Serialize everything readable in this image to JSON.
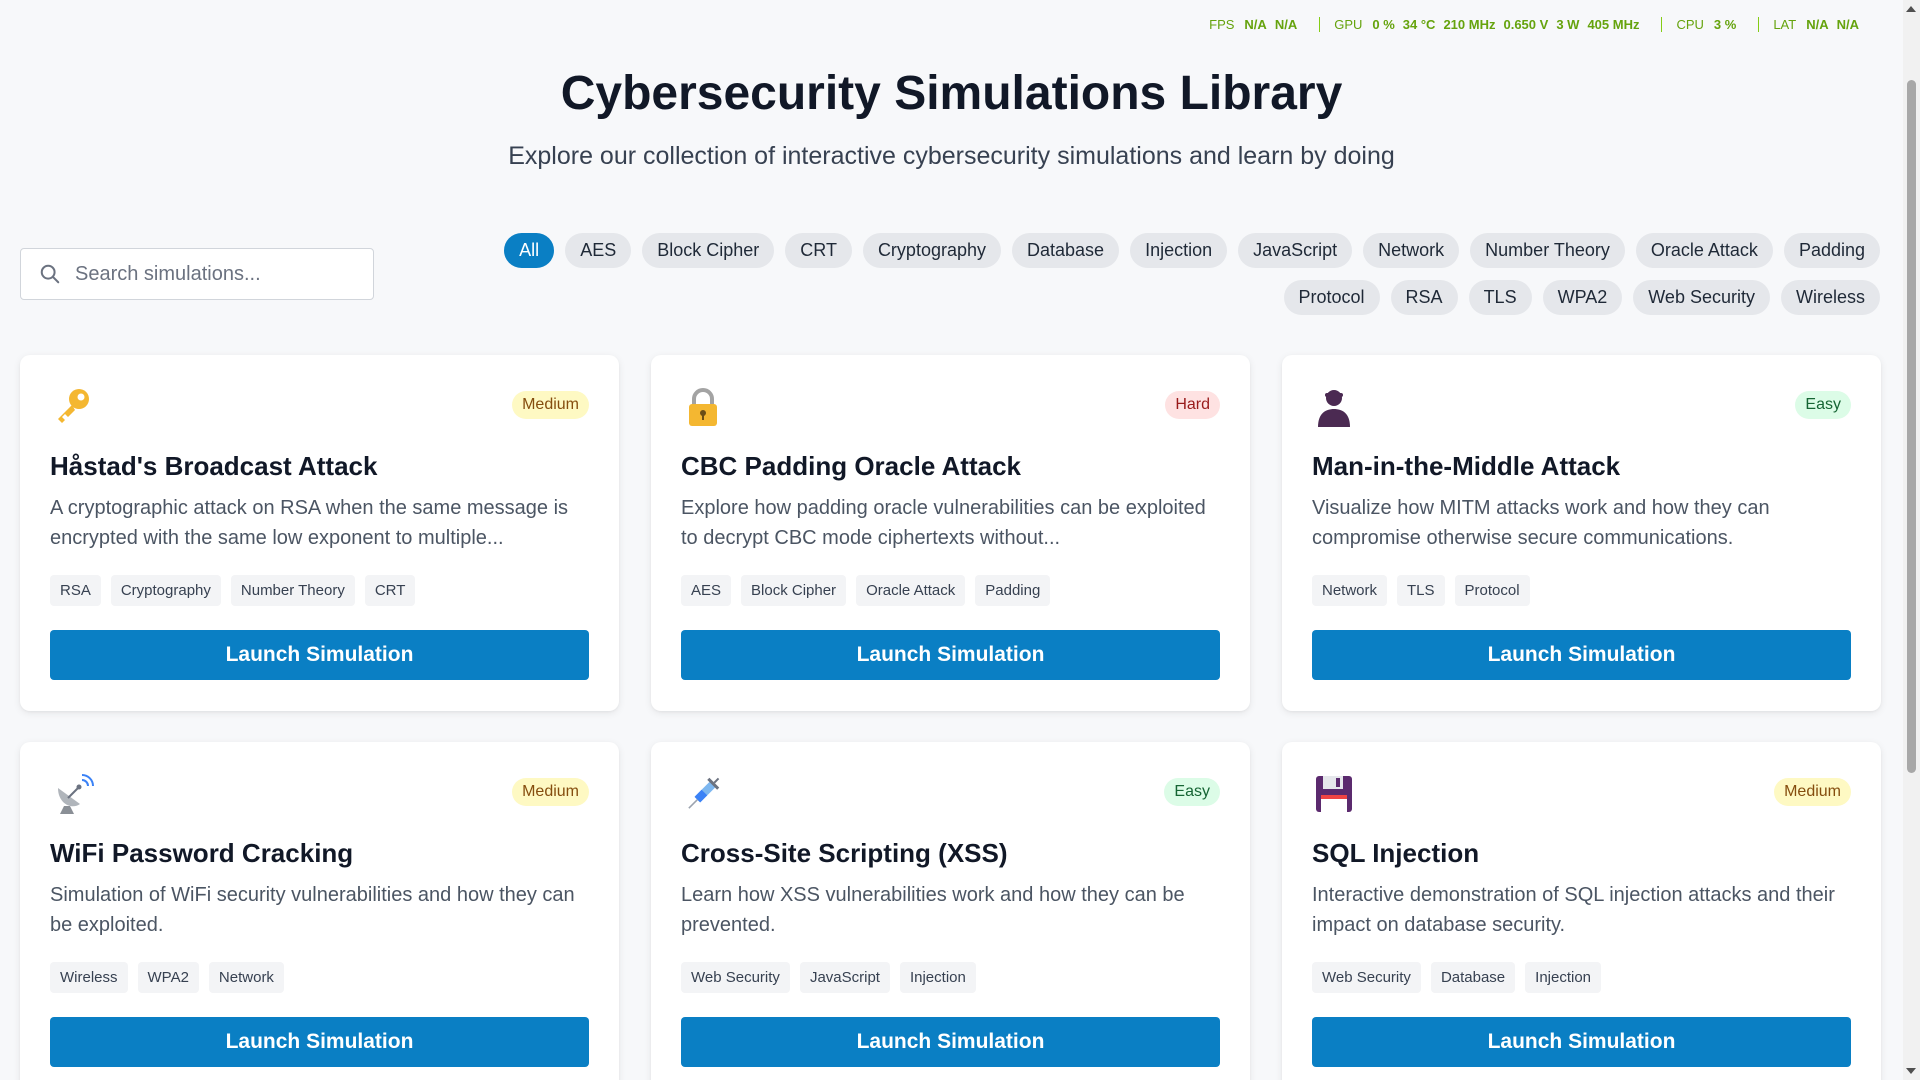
{
  "overlay": {
    "fps": {
      "label": "FPS",
      "v1": "N/A",
      "v2": "N/A"
    },
    "gpu": {
      "label": "GPU",
      "load": "0 %",
      "temp": "34 °C",
      "clock": "210 MHz",
      "volt": "0.650 V",
      "power": "3 W",
      "mem": "405 MHz"
    },
    "cpu": {
      "label": "CPU",
      "load": "3 %"
    },
    "lat": {
      "label": "LAT",
      "v1": "N/A",
      "v2": "N/A"
    }
  },
  "header": {
    "title": "Cybersecurity Simulations Library",
    "subtitle": "Explore our collection of interactive cybersecurity simulations and learn by doing"
  },
  "search": {
    "placeholder": "Search simulations...",
    "value": ""
  },
  "filters": [
    "All",
    "AES",
    "Block Cipher",
    "CRT",
    "Cryptography",
    "Database",
    "Injection",
    "JavaScript",
    "Network",
    "Number Theory",
    "Oracle Attack",
    "Padding",
    "Protocol",
    "RSA",
    "TLS",
    "WPA2",
    "Web Security",
    "Wireless"
  ],
  "active_filter": "All",
  "launch_label": "Launch Simulation",
  "cards": [
    {
      "icon": "key-icon",
      "difficulty": "Medium",
      "title": "Håstad's Broadcast Attack",
      "description": "A cryptographic attack on RSA when the same message is encrypted with the same low exponent to multiple...",
      "tags": [
        "RSA",
        "Cryptography",
        "Number Theory",
        "CRT"
      ]
    },
    {
      "icon": "lock-icon",
      "difficulty": "Hard",
      "title": "CBC Padding Oracle Attack",
      "description": "Explore how padding oracle vulnerabilities can be exploited to decrypt CBC mode ciphertexts without...",
      "tags": [
        "AES",
        "Block Cipher",
        "Oracle Attack",
        "Padding"
      ]
    },
    {
      "icon": "person-silhouette-icon",
      "difficulty": "Easy",
      "title": "Man-in-the-Middle Attack",
      "description": "Visualize how MITM attacks work and how they can compromise otherwise secure communications.",
      "tags": [
        "Network",
        "TLS",
        "Protocol"
      ]
    },
    {
      "icon": "satellite-dish-icon",
      "difficulty": "Medium",
      "title": "WiFi Password Cracking",
      "description": "Simulation of WiFi security vulnerabilities and how they can be exploited.",
      "tags": [
        "Wireless",
        "WPA2",
        "Network"
      ]
    },
    {
      "icon": "syringe-icon",
      "difficulty": "Easy",
      "title": "Cross-Site Scripting (XSS)",
      "description": "Learn how XSS vulnerabilities work and how they can be prevented.",
      "tags": [
        "Web Security",
        "JavaScript",
        "Injection"
      ]
    },
    {
      "icon": "floppy-disk-icon",
      "difficulty": "Medium",
      "title": "SQL Injection",
      "description": "Interactive demonstration of SQL injection attacks and their impact on database security.",
      "tags": [
        "Web Security",
        "Database",
        "Injection"
      ]
    }
  ]
}
